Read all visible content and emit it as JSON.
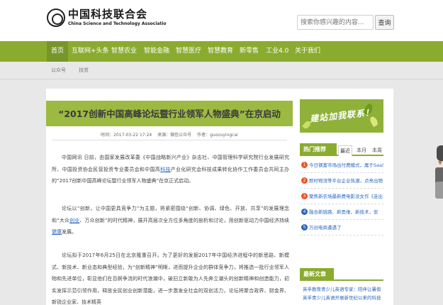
{
  "header": {
    "logo_cn": "中国科技联合会",
    "logo_en": "China Science and Technology Associatio",
    "search_placeholder": "搜索你感兴趣的内容...",
    "search_button": "查询"
  },
  "nav": {
    "items": [
      "首页",
      "互联网+头条",
      "智慧农业",
      "智能金融",
      "智慧医疗",
      "智慧教育",
      "新零售",
      "工业4.0",
      "关于我们"
    ],
    "active_index": 0
  },
  "breadcrumb": [
    "公众号",
    "扶贫"
  ],
  "article": {
    "title": "“2017创新中国高峰论坛暨行业领军人物盛典”在京启动",
    "meta": {
      "time": "时间：2017-03-22 17:24",
      "source": "来源：微信公众号",
      "author": "作者：guozuyingcai"
    },
    "p1": "中国网讯 日前，由国家发展改革委《中国战略新兴产业》杂志社、中国管理科学研究院行业发展研究所、中国投资协会民营投资专业委员会和中国高",
    "p1_link": "科技",
    "p1_rest": "产业化研究会科技成果转化协作工作委员会共同主办的“2017创新中国高峰论坛暨行业领军人物盛典”在京正式启动。",
    "p2": "论坛以“创新，让中国更具竞争力”为主题，将紧密围绕“创新、协调、绿色、开放、共享”的发展理念和“大众",
    "p2_link1": "创业",
    "p2_mid": "、万众创新”的时代精神，展开高层次全方位多角度的剖析和讨论，用创新驱动力中国经济持续",
    "p2_link2": "健康",
    "p2_rest": "发展。",
    "p3": "论坛拟于2017年6月25日在北京隆重召开。为了更好的发掘2017年中国经济进程中的新思路、新模式、新技术、新业态和典型经验，为“创新精神”明晰，进而提升企业的群体竞争力，将推选一批行业领军人物和先进单位，彰显他们在百舸争流的时代浪潮中，破旧立新敢为人先奔立潮头的创新精神和创造能力，初实发挥示范引领作用，释放全民创业创新潜能，进一步激发全社会的双创活力，论坛将聚合政界、财金界、新锐企业家、技术精英"
  },
  "sidebar": {
    "banner_text": "建站加我联系！",
    "hot_title": "热门推荐",
    "hot_tabs": [
      "最近",
      "本月",
      "本周"
    ],
    "hot_active": 0,
    "hot_items": [
      {
        "num": "1",
        "text": "今日钢富市场出付费模式，属于SaaS"
      },
      {
        "num": "2",
        "text": "即时物流等平台企业热潮，点亮出物"
      },
      {
        "num": "3",
        "text": "聚焦新农场最新费电影没女作《走出"
      },
      {
        "num": "4",
        "text": "融合新链路、新思维、新技术，安"
      },
      {
        "num": "5",
        "text": "万创电商遭遇了"
      }
    ],
    "hot_colors": [
      "#e8552b",
      "#e8552b",
      "#e8552b",
      "#2a66c0",
      "#2a66c0"
    ],
    "latest_title": "最新文章",
    "latest_items": [
      "英孚教育青少儿英语专家：陪伴让暑假",
      "英孚青少儿英语开展新世纪以来的科技"
    ]
  }
}
